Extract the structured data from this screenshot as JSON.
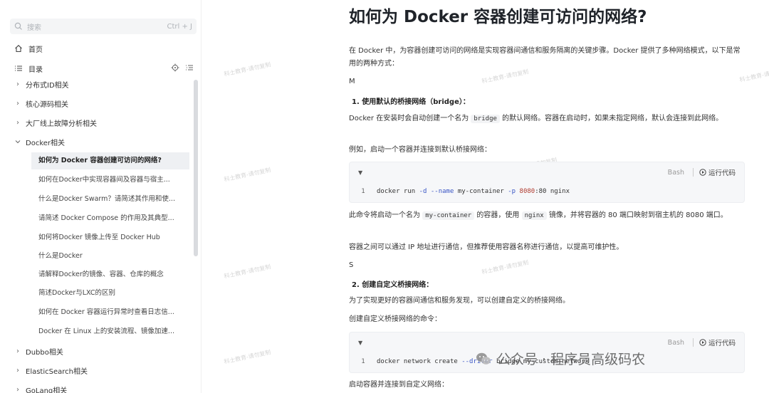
{
  "sidebar": {
    "search": {
      "placeholder": "搜索",
      "shortcut": "Ctrl + J"
    },
    "home": "首页",
    "toc": "目录",
    "tree": [
      {
        "label": "分布式ID相关",
        "expanded": false
      },
      {
        "label": "核心源码相关",
        "expanded": false
      },
      {
        "label": "大厂线上故障分析相关",
        "expanded": false
      },
      {
        "label": "Docker相关",
        "expanded": true
      }
    ],
    "docker_children": [
      "如何为 Docker 容器创建可访问的网络?",
      "如何在Docker中实现容器间及容器与宿主...",
      "什么是Docker Swarm？请简述其作用和使...",
      "请简述 Docker Compose 的作用及其典型...",
      "如何将Docker 镜像上传至 Docker Hub",
      "什么是Docker",
      "请解释Docker的镜像、容器、仓库的概念",
      "简述Docker与LXC的区别",
      "如何在 Docker 容器运行异常时查看日志信...",
      "Docker 在 Linux 上的安装流程、镜像加速..."
    ],
    "tree_after": [
      {
        "label": "Dubbo相关",
        "expanded": false
      },
      {
        "label": "ElasticSearch相关",
        "expanded": false
      },
      {
        "label": "GoLang相关",
        "expanded": false
      }
    ]
  },
  "main": {
    "title": "如何为 Docker 容器创建可访问的网络?",
    "intro": "在 Docker 中，为容器创建可访问的网络是实现容器间通信和服务隔离的关键步骤。Docker 提供了多种网络模式，以下是常用的两种方式：",
    "letter_m": "M",
    "h1": "1. 使用默认的桥接网络（bridge）：",
    "p1_before": "Docker 在安装时会自动创建一个名为",
    "p1_code": "bridge",
    "p1_after": "的默认网络。容器在启动时，如果未指定网络，默认会连接到此网络。",
    "p2": "例如，启动一个容器并连接到默认桥接网络：",
    "code1": {
      "lang": "Bash",
      "run": "运行代码",
      "line_no": "1",
      "cmd": "docker run",
      "opt1": "-d",
      "opt2": "--name",
      "arg1": "my-container",
      "opt3": "-p",
      "port_a": "8080",
      "port_b": ":80 nginx"
    },
    "p3_a": "此命令将启动一个名为",
    "p3_code1": "my-container",
    "p3_b": "的容器，使用",
    "p3_code2": "nginx",
    "p3_c": "镜像，并将容器的 80 端口映射到宿主机的 8080 端口。",
    "p4": "容器之间可以通过 IP 地址进行通信，但推荐使用容器名称进行通信，以提高可维护性。",
    "letter_s": "S",
    "h2": "2. 创建自定义桥接网络：",
    "p5": "为了实现更好的容器间通信和服务发现，可以创建自定义的桥接网络。",
    "p6": "创建自定义桥接网络的命令：",
    "code2": {
      "lang": "Bash",
      "run": "运行代码",
      "line_no": "1",
      "cmd": "docker network create",
      "opt1": "--driver",
      "rest": "bridge my-custom-network"
    },
    "p7": "启动容器并连接到自定义网络："
  },
  "watermark": {
    "text": "科士教育-请勿复制",
    "overlay": "公众号 · 程序员高级码农"
  }
}
